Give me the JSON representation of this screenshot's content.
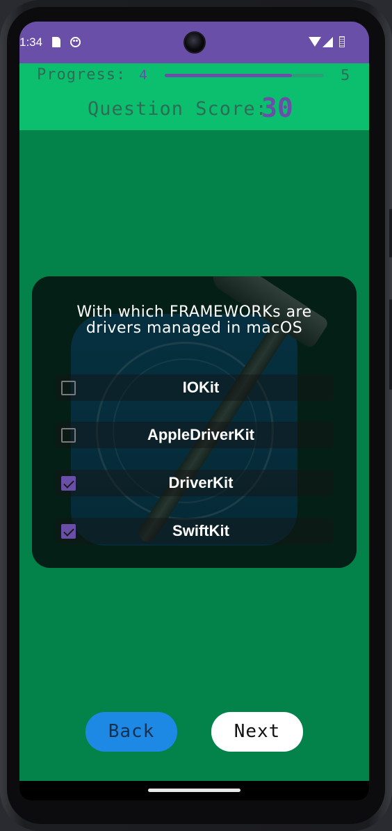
{
  "status_bar": {
    "time": "1:34",
    "icons": [
      "sd-card-icon",
      "face-icon",
      "wifi-icon",
      "cellular-signal-icon",
      "battery-icon"
    ]
  },
  "header": {
    "progress_label": "Progress:",
    "progress_current": "4",
    "progress_max": "5",
    "progress_fraction": 0.8,
    "score_label": "Question Score:",
    "score_value": "30"
  },
  "question": {
    "text": "With which FRAMEWORKs are drivers managed in macOS",
    "options": [
      {
        "label": "IOKit",
        "checked": false
      },
      {
        "label": "AppleDriverKit",
        "checked": false
      },
      {
        "label": "DriverKit",
        "checked": true
      },
      {
        "label": "SwiftKit",
        "checked": true
      }
    ]
  },
  "buttons": {
    "back": "Back",
    "next": "Next"
  },
  "colors": {
    "status_bar": "#6a4fa8",
    "header": "#0bbf6e",
    "background": "#03824a",
    "accent": "#6a4fa8",
    "back_button": "#1e88e5"
  }
}
